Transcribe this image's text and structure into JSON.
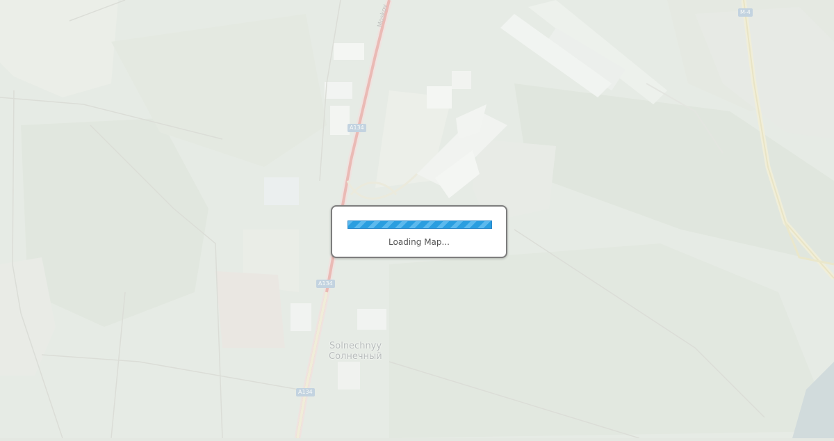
{
  "map": {
    "place_label_latin": "Solnechnyy",
    "place_label_cyrillic": "Солнечный",
    "road_name": "Moskov",
    "shields": [
      "A134",
      "A134",
      "A134",
      "M-4"
    ]
  },
  "loading": {
    "text": "Loading Map...",
    "progress": 1.0
  },
  "colors": {
    "progress_fill": "#2a9ee0",
    "dialog_border": "#7d7d7d",
    "highway": "#e58a86"
  }
}
